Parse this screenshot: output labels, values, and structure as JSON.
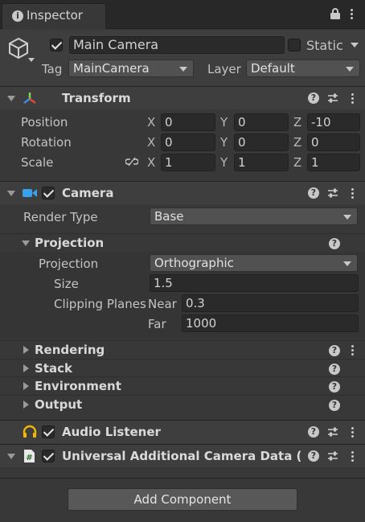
{
  "tab": {
    "title": "Inspector"
  },
  "object": {
    "name": "Main Camera",
    "static_label": "Static",
    "tag_label": "Tag",
    "tag_value": "MainCamera",
    "layer_label": "Layer",
    "layer_value": "Default"
  },
  "transform": {
    "title": "Transform",
    "rows": [
      {
        "label": "Position",
        "x": "0",
        "y": "0",
        "z": "-10"
      },
      {
        "label": "Rotation",
        "x": "0",
        "y": "0",
        "z": "0"
      },
      {
        "label": "Scale",
        "x": "1",
        "y": "1",
        "z": "1"
      }
    ],
    "axes": {
      "x": "X",
      "y": "Y",
      "z": "Z"
    }
  },
  "camera": {
    "title": "Camera",
    "render_type_label": "Render Type",
    "render_type_value": "Base",
    "projection_section": "Projection",
    "projection_label": "Projection",
    "projection_value": "Orthographic",
    "size_label": "Size",
    "size_value": "1.5",
    "clipping_label": "Clipping Planes",
    "near_label": "Near",
    "near_value": "0.3",
    "far_label": "Far",
    "far_value": "1000",
    "sections": [
      "Rendering",
      "Stack",
      "Environment",
      "Output"
    ]
  },
  "audio_listener": {
    "title": "Audio Listener"
  },
  "urp_data": {
    "title": "Universal Additional Camera Data (Sc"
  },
  "add_component": "Add Component",
  "colors": {
    "panel": "#383838",
    "header": "#3e3e3e",
    "field": "#2a2a2a",
    "dropdown": "#515151",
    "audio_icon": "#f2b705",
    "camera_icon": "#3aa0e8"
  }
}
